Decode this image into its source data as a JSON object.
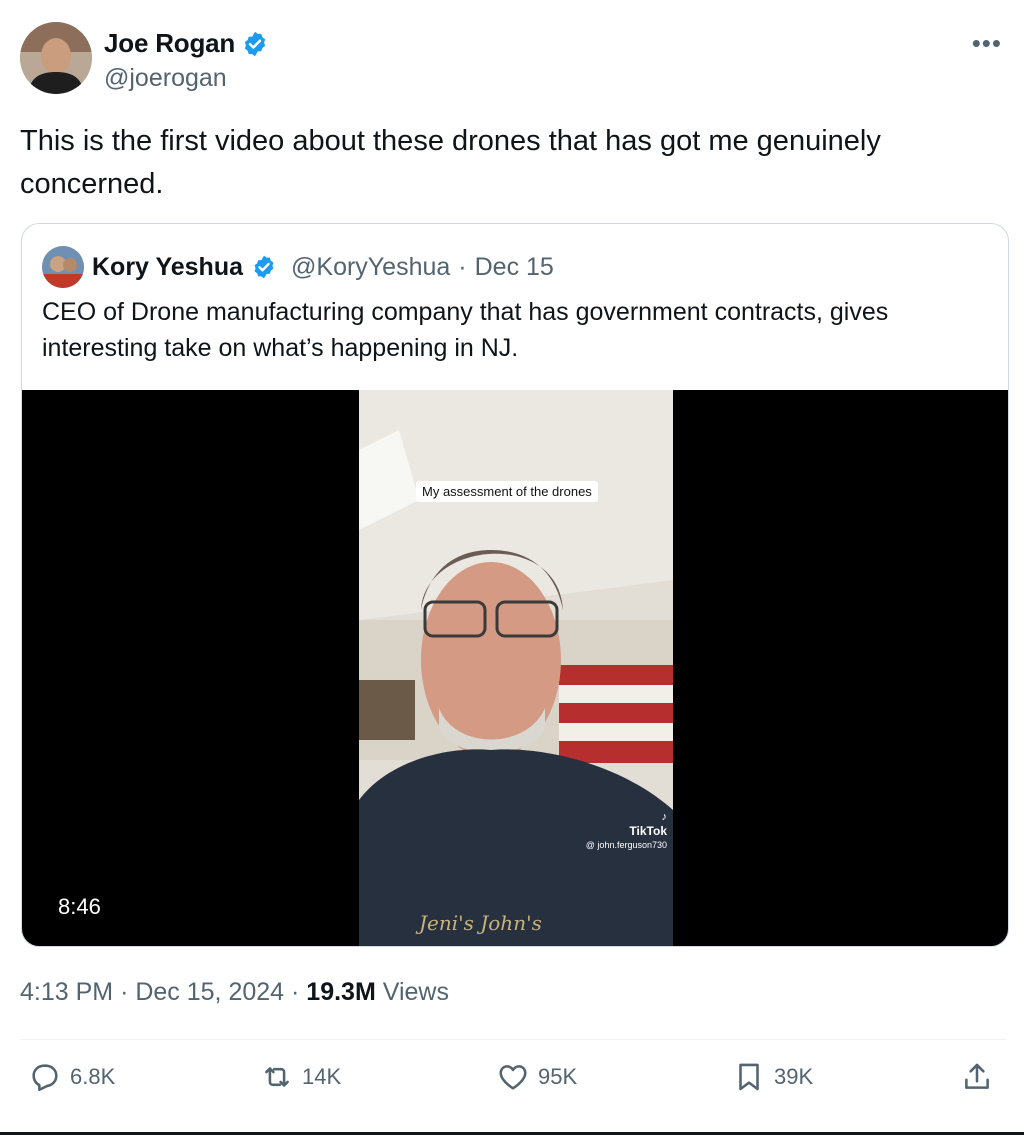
{
  "author": {
    "name": "Joe Rogan",
    "handle": "@joerogan",
    "verified": true
  },
  "more_icon": "more-icon",
  "tweet": {
    "text": "This is the first video about these drones that has got me genuinely concerned."
  },
  "quoted": {
    "name": "Kory Yeshua",
    "handle": "@KoryYeshua",
    "separator": "·",
    "date": "Dec 15",
    "text": "CEO of Drone manufacturing company that has government contracts, gives interesting take on what’s happening in NJ.",
    "video": {
      "caption": "My assessment of the drones",
      "watermark_brand": "TikTok",
      "watermark_user": "@ john.ferguson730",
      "duration": "8:46"
    }
  },
  "meta": {
    "time": "4:13 PM",
    "sep1": "·",
    "date": "Dec 15, 2024",
    "sep2": "·",
    "views_count": "19.3M",
    "views_label": "Views"
  },
  "actions": {
    "replies": "6.8K",
    "reposts": "14K",
    "likes": "95K",
    "bookmarks": "39K"
  },
  "colors": {
    "verified_blue": "#1d9bf0",
    "secondary_text": "#536471",
    "primary_text": "#0f1419",
    "border": "#cfd9de"
  }
}
